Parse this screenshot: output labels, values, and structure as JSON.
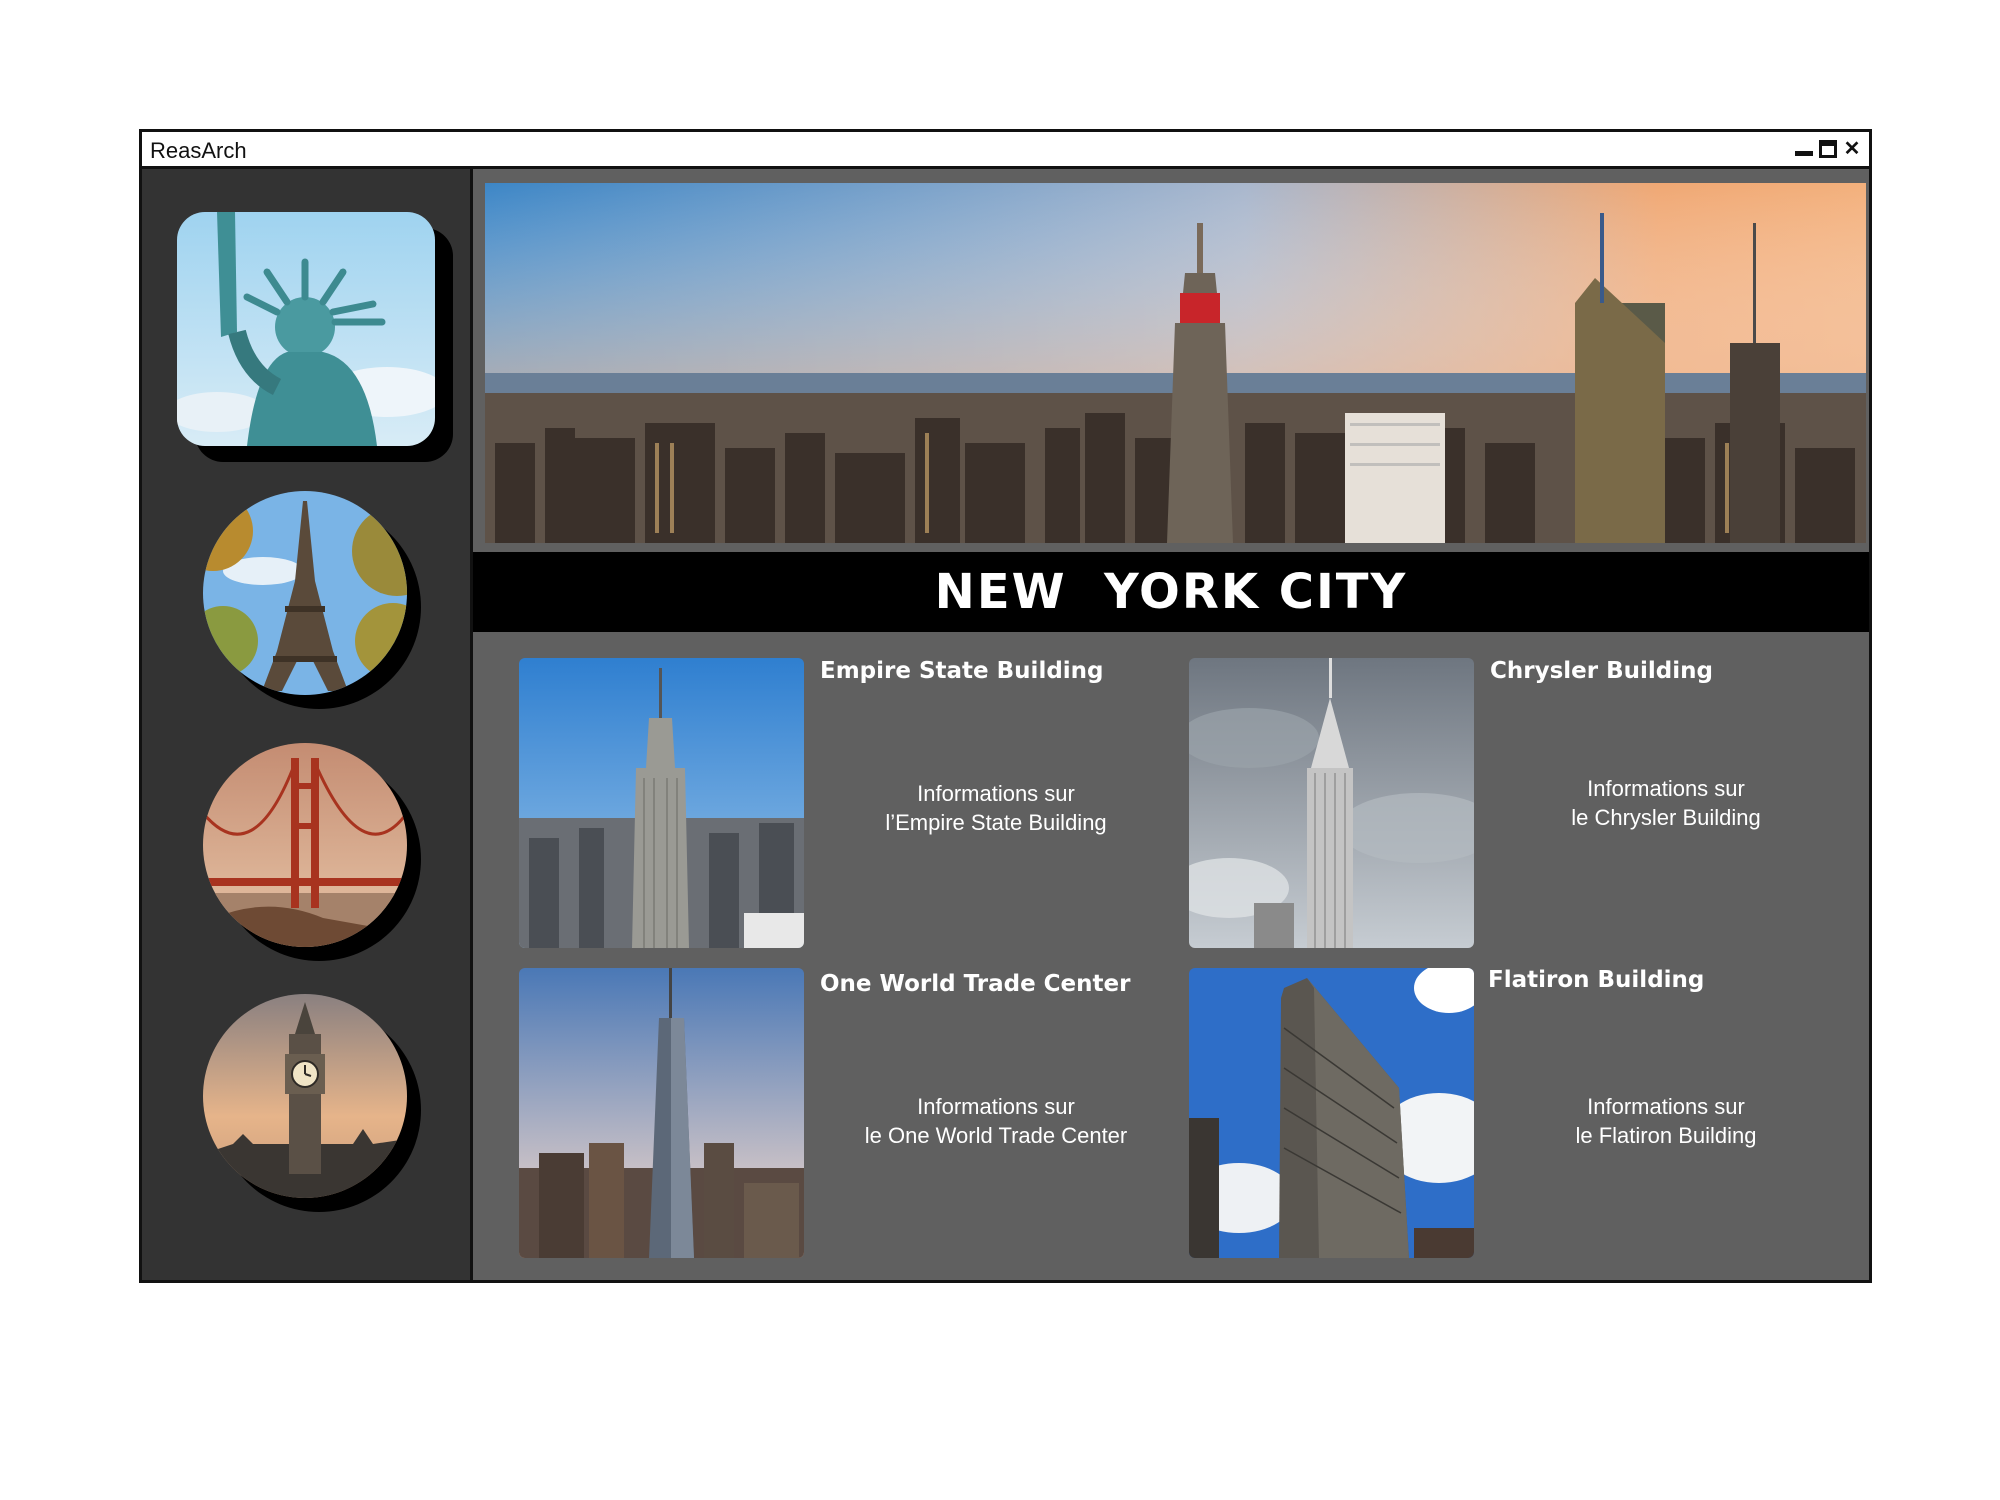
{
  "window": {
    "title": "ReasArch",
    "controls": [
      "minimize-icon",
      "maximize-icon",
      "close-icon"
    ]
  },
  "sidebar": {
    "items": [
      {
        "name": "statue-of-liberty",
        "icon": "statue-of-liberty-image"
      },
      {
        "name": "eiffel-tower",
        "icon": "eiffel-tower-image"
      },
      {
        "name": "golden-gate-bridge",
        "icon": "golden-gate-bridge-image"
      },
      {
        "name": "big-ben",
        "icon": "big-ben-image"
      }
    ]
  },
  "main": {
    "title": "NEW  YORK CITY",
    "cards": [
      {
        "heading": "Empire State Building",
        "info_line1": "Informations sur",
        "info_line2": "l’Empire State Building"
      },
      {
        "heading": "Chrysler Building",
        "info_line1": "Informations sur",
        "info_line2": "le Chrysler Building"
      },
      {
        "heading": "One World Trade Center",
        "info_line1": "Informations sur",
        "info_line2": "le One World Trade Center"
      },
      {
        "heading": "Flatiron Building",
        "info_line1": "Informations sur",
        "info_line2": "le Flatiron Building"
      }
    ]
  },
  "colors": {
    "sidebar_bg": "#333333",
    "main_bg": "#606060",
    "title_band": "#000000",
    "text": "#ffffff"
  }
}
